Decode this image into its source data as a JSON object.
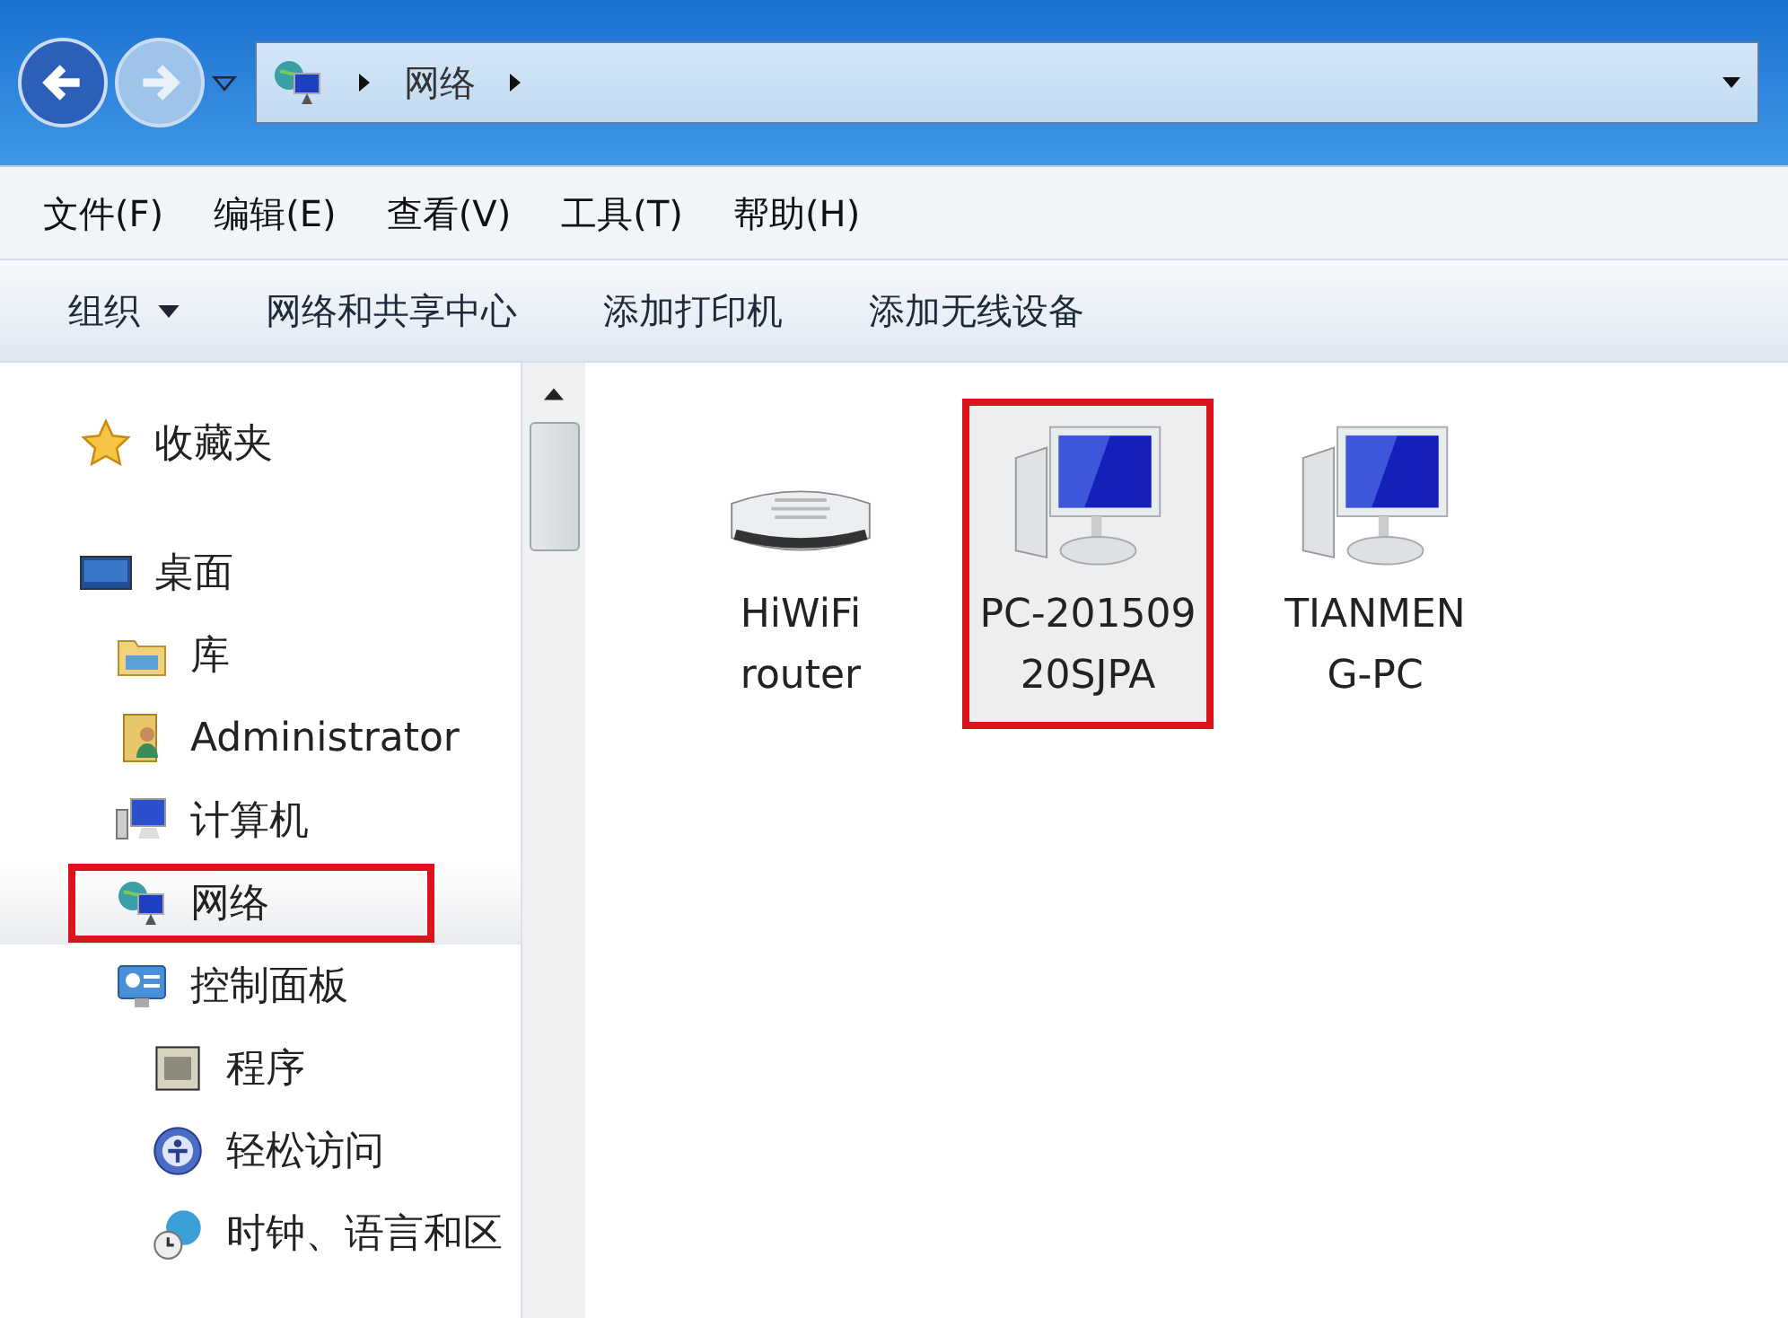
{
  "address_bar": {
    "path": [
      "网络"
    ]
  },
  "menu_bar": [
    "文件(F)",
    "编辑(E)",
    "查看(V)",
    "工具(T)",
    "帮助(H)"
  ],
  "toolbar": [
    {
      "label": "组织",
      "dropdown": true
    },
    {
      "label": "网络和共享中心",
      "dropdown": false
    },
    {
      "label": "添加打印机",
      "dropdown": false
    },
    {
      "label": "添加无线设备",
      "dropdown": false
    }
  ],
  "sidebar": {
    "items": [
      {
        "label": "收藏夹",
        "kind": "star",
        "selected": false,
        "highlighted": false
      },
      {
        "label": "桌面",
        "kind": "desktop",
        "selected": false,
        "highlighted": false,
        "children": [
          {
            "label": "库",
            "kind": "library",
            "selected": false,
            "highlighted": false
          },
          {
            "label": "Administrator",
            "kind": "user",
            "selected": false,
            "highlighted": false
          },
          {
            "label": "计算机",
            "kind": "computer",
            "selected": false,
            "highlighted": false
          },
          {
            "label": "网络",
            "kind": "network",
            "selected": true,
            "highlighted": true
          },
          {
            "label": "控制面板",
            "kind": "control",
            "selected": false,
            "highlighted": false,
            "children": [
              {
                "label": "程序",
                "kind": "programs",
                "selected": false,
                "highlighted": false
              },
              {
                "label": "轻松访问",
                "kind": "access",
                "selected": false,
                "highlighted": false
              },
              {
                "label": "时钟、语言和区",
                "kind": "clock",
                "selected": false,
                "highlighted": false
              }
            ]
          }
        ]
      }
    ]
  },
  "devices": [
    {
      "kind": "router",
      "name_lines": [
        "HiWiFi",
        "router"
      ],
      "selected": false,
      "highlighted": false
    },
    {
      "kind": "computer",
      "name_lines": [
        "PC-201509",
        "20SJPA"
      ],
      "selected": true,
      "highlighted": true
    },
    {
      "kind": "computer",
      "name_lines": [
        "TIANMEN",
        "G-PC"
      ],
      "selected": false,
      "highlighted": false
    }
  ]
}
